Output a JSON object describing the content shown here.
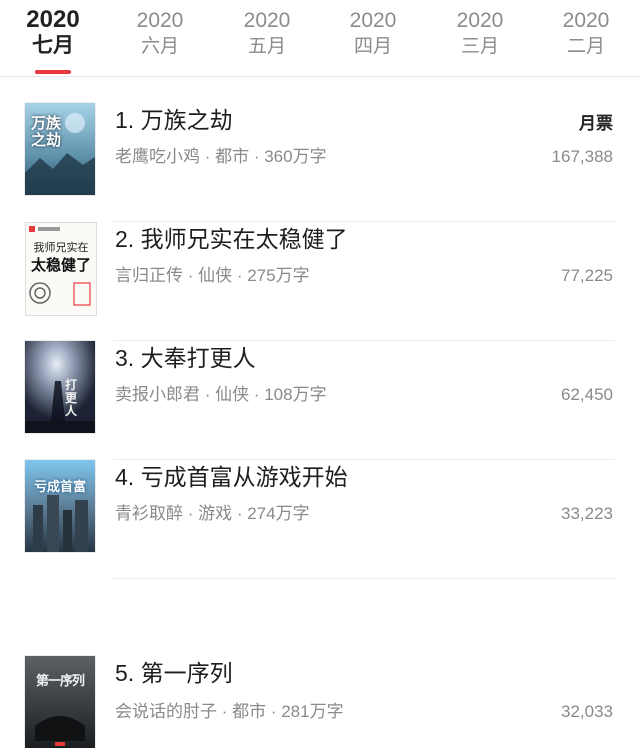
{
  "tabs": [
    {
      "year": "2020",
      "month": "七月",
      "active": true
    },
    {
      "year": "2020",
      "month": "六月"
    },
    {
      "year": "2020",
      "month": "五月"
    },
    {
      "year": "2020",
      "month": "四月"
    },
    {
      "year": "2020",
      "month": "三月"
    },
    {
      "year": "2020",
      "month": "二月"
    }
  ],
  "colors": {
    "accent": "#e8393f"
  },
  "ticket_label": "月票",
  "books": [
    {
      "title": "1. 万族之劫",
      "meta": "老鹰吃小鸡 · 都市 · 360万字",
      "count": "167,388",
      "cover_text": "万族之劫"
    },
    {
      "title": "2. 我师兄实在太稳健了",
      "meta": "言归正传 · 仙侠 · 275万字",
      "count": "77,225",
      "cover_text": [
        "我师兄实在",
        "太稳健了"
      ]
    },
    {
      "title": "3. 大奉打更人",
      "meta": "卖报小郎君 · 仙侠 · 108万字",
      "count": "62,450",
      "cover_text": "打更人"
    },
    {
      "title": "4. 亏成首富从游戏开始",
      "meta": "青衫取醉 · 游戏 · 274万字",
      "count": "33,223",
      "cover_text": "亏成首富"
    },
    {
      "title": "5. 第一序列",
      "meta": "会说话的肘子 · 都市 · 281万字",
      "count": "32,033",
      "cover_text": "第一序列"
    }
  ]
}
